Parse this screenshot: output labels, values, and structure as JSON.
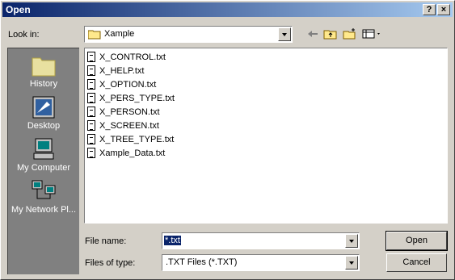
{
  "window": {
    "title": "Open",
    "help_label": "?",
    "close_label": "×"
  },
  "lookin": {
    "label": "Look in:",
    "value": "Xample"
  },
  "places": [
    {
      "label": "History"
    },
    {
      "label": "Desktop"
    },
    {
      "label": "My Computer"
    },
    {
      "label": "My Network Pl..."
    }
  ],
  "files": [
    "X_CONTROL.txt",
    "X_HELP.txt",
    "X_OPTION.txt",
    "X_PERS_TYPE.txt",
    "X_PERSON.txt",
    "X_SCREEN.txt",
    "X_TREE_TYPE.txt",
    "Xample_Data.txt"
  ],
  "filename": {
    "label": "File name:",
    "value": "*.txt"
  },
  "filetype": {
    "label": "Files of type:",
    "value": ".TXT Files (*.TXT)"
  },
  "buttons": {
    "open": "Open",
    "cancel": "Cancel"
  },
  "colors": {
    "titlebar_start": "#0a246a",
    "titlebar_end": "#a6caf0",
    "face": "#d4d0c8",
    "places_bg": "#808080"
  }
}
